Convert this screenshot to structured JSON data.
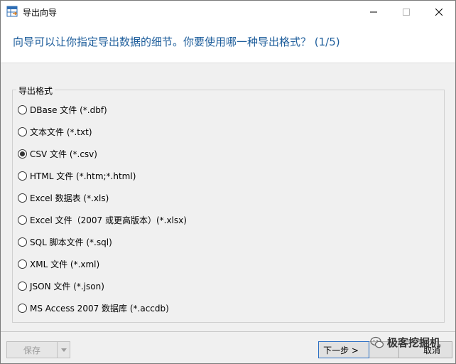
{
  "window": {
    "title": "导出向导",
    "question": "向导可以让你指定导出数据的细节。你要使用哪一种导出格式？ (1/5)"
  },
  "export_format": {
    "group_label": "导出格式",
    "options": [
      {
        "label": "DBase 文件 (*.dbf)",
        "checked": false
      },
      {
        "label": "文本文件 (*.txt)",
        "checked": false
      },
      {
        "label": "CSV 文件 (*.csv)",
        "checked": true
      },
      {
        "label": "HTML 文件 (*.htm;*.html)",
        "checked": false
      },
      {
        "label": "Excel 数据表 (*.xls)",
        "checked": false
      },
      {
        "label": "Excel 文件（2007 或更高版本）(*.xlsx)",
        "checked": false
      },
      {
        "label": "SQL 脚本文件 (*.sql)",
        "checked": false
      },
      {
        "label": "XML 文件 (*.xml)",
        "checked": false
      },
      {
        "label": "JSON 文件 (*.json)",
        "checked": false
      },
      {
        "label": "MS Access 2007 数据库 (*.accdb)",
        "checked": false
      }
    ]
  },
  "buttons": {
    "save": "保存",
    "next": "下一步 >",
    "cancel": "取消"
  },
  "watermark": "极客挖掘机",
  "colors": {
    "question_text": "#1d5d9b",
    "title_bar": "#ffffff",
    "dialog_bg": "#f0f0f0"
  }
}
